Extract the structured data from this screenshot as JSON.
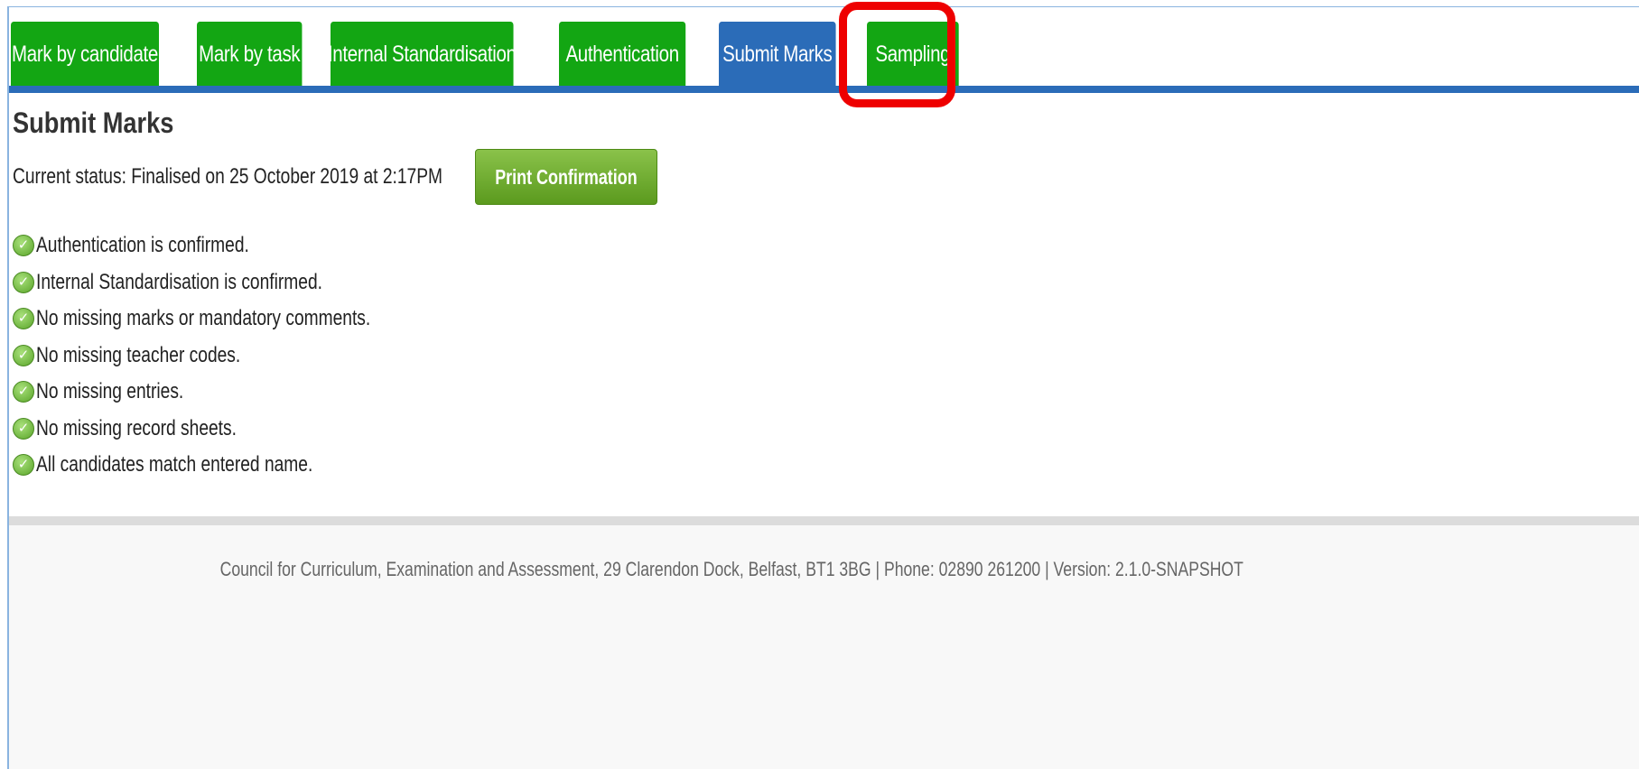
{
  "tabs": [
    {
      "label": "Mark by candidate",
      "color": "#13a613",
      "active": false
    },
    {
      "label": "Mark by task",
      "color": "#13a613",
      "active": false
    },
    {
      "label": "Internal Standardisation",
      "color": "#13a613",
      "active": false
    },
    {
      "label": "Authentication",
      "color": "#13a613",
      "active": false
    },
    {
      "label": "Submit Marks",
      "color": "#2b6cb8",
      "active": true
    },
    {
      "label": "Sampling",
      "color": "#13a613",
      "active": false
    }
  ],
  "highlight_color": "#ee0000",
  "page": {
    "title": "Submit Marks",
    "status_text": "Current status: Finalised on 25 October 2019 at 2:17PM",
    "print_button_label": "Print Confirmation"
  },
  "checks": [
    {
      "icon": "check-circle-icon",
      "text": "Authentication is confirmed."
    },
    {
      "icon": "check-circle-icon",
      "text": "Internal Standardisation is confirmed."
    },
    {
      "icon": "check-circle-icon",
      "text": "No missing marks or mandatory comments."
    },
    {
      "icon": "check-circle-icon",
      "text": "No missing teacher codes."
    },
    {
      "icon": "check-circle-icon",
      "text": "No missing entries."
    },
    {
      "icon": "check-circle-icon",
      "text": "No missing record sheets."
    },
    {
      "icon": "check-circle-icon",
      "text": "All candidates match entered name."
    }
  ],
  "footer": {
    "text": "Council for Curriculum, Examination and Assessment, 29 Clarendon Dock, Belfast, BT1 3BG | Phone: 02890 261200 | Version: 2.1.0-SNAPSHOT"
  }
}
